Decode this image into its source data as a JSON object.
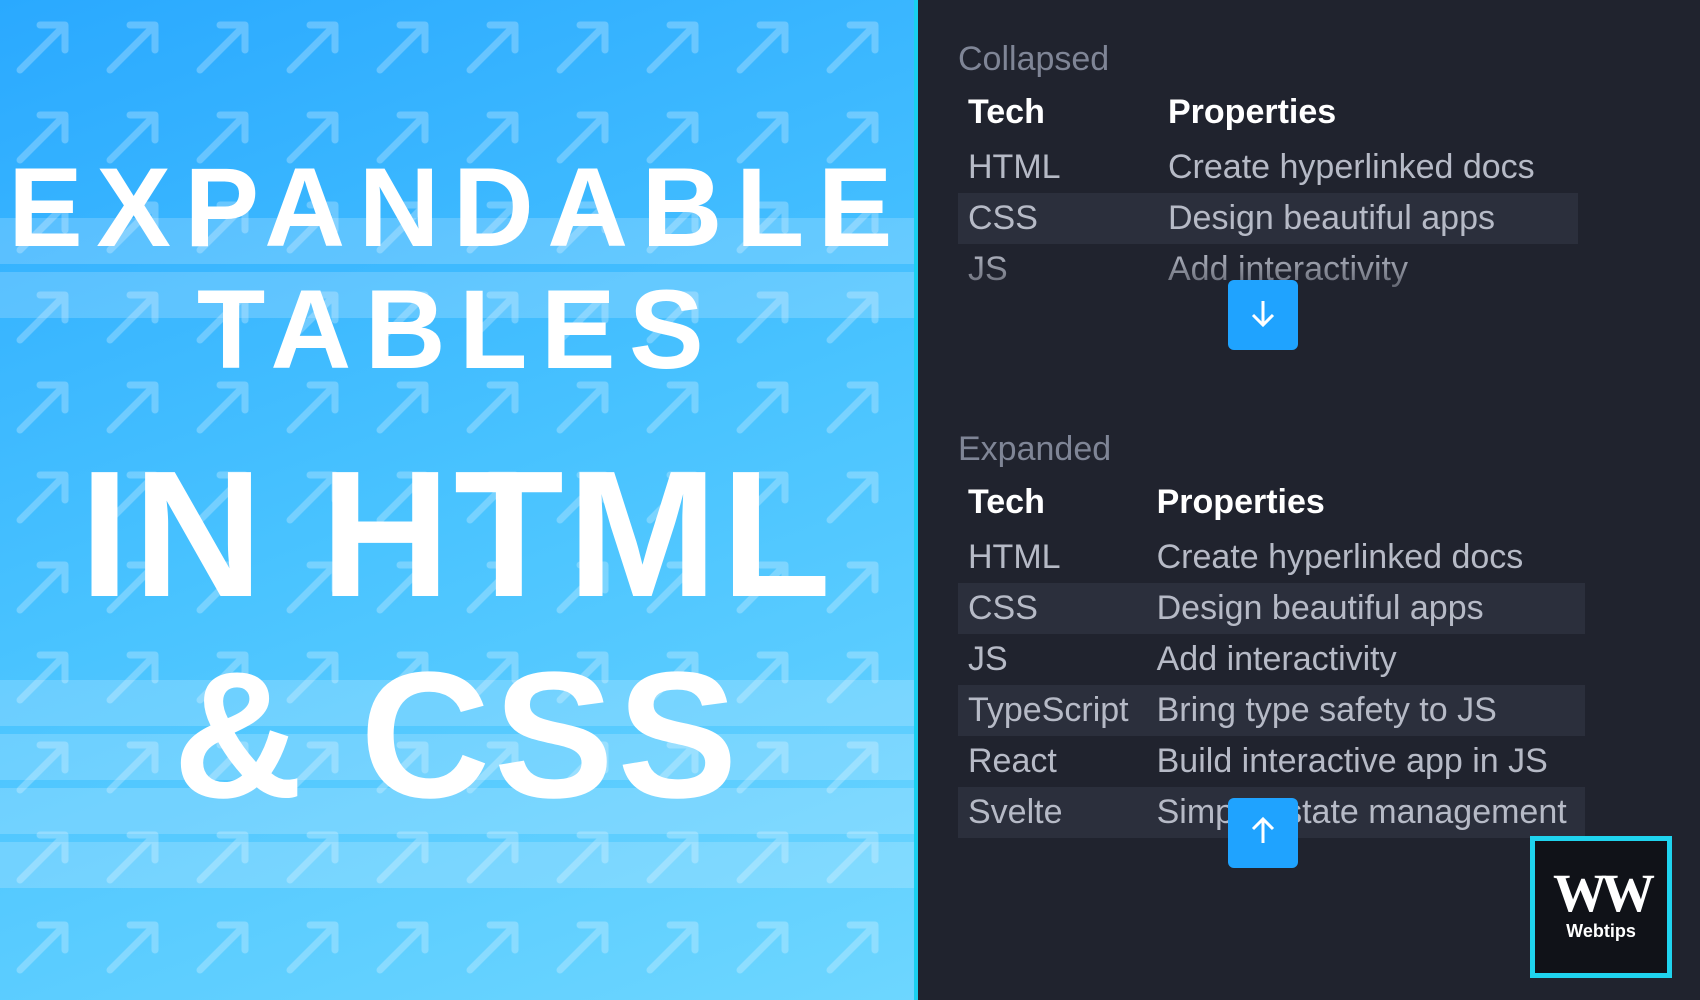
{
  "hero": {
    "line1": "EXPANDABLE",
    "line2": "TABLES",
    "line3": "IN HTML",
    "line4": "& CSS"
  },
  "sections": {
    "collapsed_label": "Collapsed",
    "expanded_label": "Expanded"
  },
  "table": {
    "headers": {
      "tech": "Tech",
      "properties": "Properties"
    },
    "rows": [
      {
        "tech": "HTML",
        "properties": "Create hyperlinked docs"
      },
      {
        "tech": "CSS",
        "properties": "Design beautiful apps"
      },
      {
        "tech": "JS",
        "properties": "Add interactivity"
      },
      {
        "tech": "TypeScript",
        "properties": "Bring type safety to JS"
      },
      {
        "tech": "React",
        "properties": "Build interactive app in JS"
      },
      {
        "tech": "Svelte",
        "properties": "Simplify state management"
      }
    ]
  },
  "logo": {
    "mark": "WW",
    "sub": "Webtips"
  },
  "colors": {
    "accent": "#1fa3ff",
    "cyan": "#1fd3ee",
    "dark": "#20232e"
  }
}
